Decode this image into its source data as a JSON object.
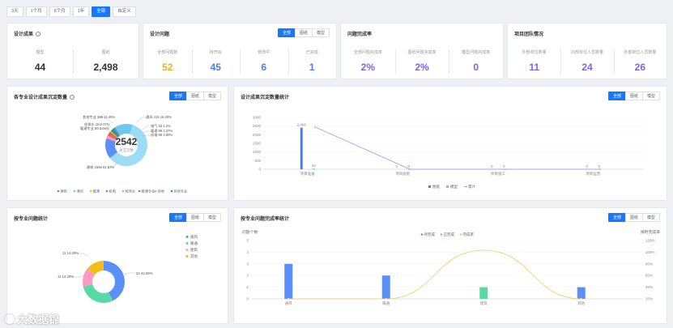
{
  "time_tabs": [
    "3天",
    "1个月",
    "6个月",
    "1年",
    "全部",
    "自定义"
  ],
  "segment": [
    "全部",
    "图纸",
    "模型"
  ],
  "design_results": {
    "title": "设计成果",
    "stats": [
      {
        "label": "模型",
        "value": "44"
      },
      {
        "label": "图纸",
        "value": "2,498"
      }
    ]
  },
  "design_issues": {
    "title": "设计问题",
    "stats": [
      {
        "label": "全部问题数",
        "value": "52"
      },
      {
        "label": "待开始",
        "value": "45"
      },
      {
        "label": "修改中",
        "value": "6"
      },
      {
        "label": "已完成",
        "value": "1"
      }
    ]
  },
  "completion_rate": {
    "title": "问题完成率",
    "stats": [
      {
        "label": "全部问题完成率",
        "value": "2%"
      },
      {
        "label": "图纸问题完成率",
        "value": "2%"
      },
      {
        "label": "模型问题完成率",
        "value": "0"
      }
    ]
  },
  "team": {
    "title": "项目团队情况",
    "stats": [
      {
        "label": "外部单位数量",
        "value": "11"
      },
      {
        "label": "内部单位人员数量",
        "value": "24"
      },
      {
        "label": "外部单位人员数量",
        "value": "26"
      }
    ]
  },
  "donut1": {
    "title": "各专业设计成果沉淀数量",
    "center_value": "2542",
    "center_label": "总沉淀数",
    "callouts": [
      {
        "text": "其他专业 299 14.46%"
      },
      {
        "text": "给排水 10 0.77%"
      },
      {
        "text": "暖通专业 80 3.04%"
      },
      {
        "text": "通风 415 16.33%"
      },
      {
        "text": "电气 53 1.2%"
      },
      {
        "text": "暖通 89 2.37%"
      },
      {
        "text": "机电 88 3.69%"
      },
      {
        "text": "建筑 1565 61.57%"
      }
    ],
    "legend": [
      "建筑",
      "通风",
      "暖通",
      "机电",
      "给排水",
      "暖通专业",
      "其他",
      "其他专业"
    ],
    "colors": [
      "#5b8ff9",
      "#5ad8a6",
      "#f6bd16",
      "#e8684a",
      "#6dc8ec",
      "#9270ca",
      "#ff9d4d",
      "#269a99"
    ]
  },
  "chart_stats": {
    "title": "设计成果沉淀数量统计",
    "legend": [
      "图纸",
      "模型",
      "累计"
    ],
    "chart_data": {
      "type": "bar",
      "categories": [
        "项目准备",
        "项目规划",
        "项目施工",
        "项目运营"
      ],
      "series": [
        {
          "name": "图纸",
          "values": [
            2408,
            0,
            0,
            0
          ]
        },
        {
          "name": "模型",
          "values": [
            44,
            0,
            0,
            0
          ]
        },
        {
          "name": "累计",
          "values": [
            2452,
            0,
            0,
            0
          ]
        }
      ],
      "data_labels": [
        "2,408",
        "44",
        "0",
        "0",
        "0",
        "0",
        "0",
        "0"
      ],
      "ylim": [
        0,
        3000
      ],
      "yticks": [
        "3000",
        "2500",
        "2000",
        "1500",
        "1000",
        "500",
        "0"
      ]
    }
  },
  "issue_stats": {
    "title": "按专业问题统计",
    "legend": [
      "通风",
      "暖通",
      "建筑",
      "其他"
    ],
    "chart_data": {
      "type": "pie",
      "labels": [
        "建筑",
        "通风",
        "暖通",
        "其他"
      ],
      "labels_printed": [
        "22 42.86%",
        "11 14.29%",
        "11 14.29%"
      ],
      "values": [
        42.86,
        28.57,
        14.29,
        14.29
      ]
    },
    "colors": [
      "#5b8ff9",
      "#5ad8a6",
      "#ff99c3",
      "#f6bd16"
    ]
  },
  "issue_rate": {
    "title": "按专业问题完成率统计",
    "y_left_label": "问题个数",
    "y_right_label": "按时完成率",
    "legend": [
      "待完成",
      "已完成",
      "完成率"
    ],
    "chart_data": {
      "type": "bar",
      "categories": [
        "通风",
        "暖通",
        "建筑",
        "其他"
      ],
      "series": [
        {
          "name": "待完成",
          "values": [
            3,
            2,
            0,
            1
          ]
        },
        {
          "name": "已完成",
          "values": [
            0,
            0,
            1,
            0
          ]
        },
        {
          "name": "完成率",
          "values": [
            0,
            0,
            100,
            0
          ]
        }
      ],
      "ylim": [
        0,
        5
      ],
      "yticks": [
        "5",
        "4",
        "3",
        "2",
        "1",
        "0"
      ],
      "y2ticks": [
        "120%",
        "100%",
        "80%",
        "60%",
        "40%",
        "20%",
        "0%"
      ]
    }
  },
  "watermark": "大数据锦"
}
